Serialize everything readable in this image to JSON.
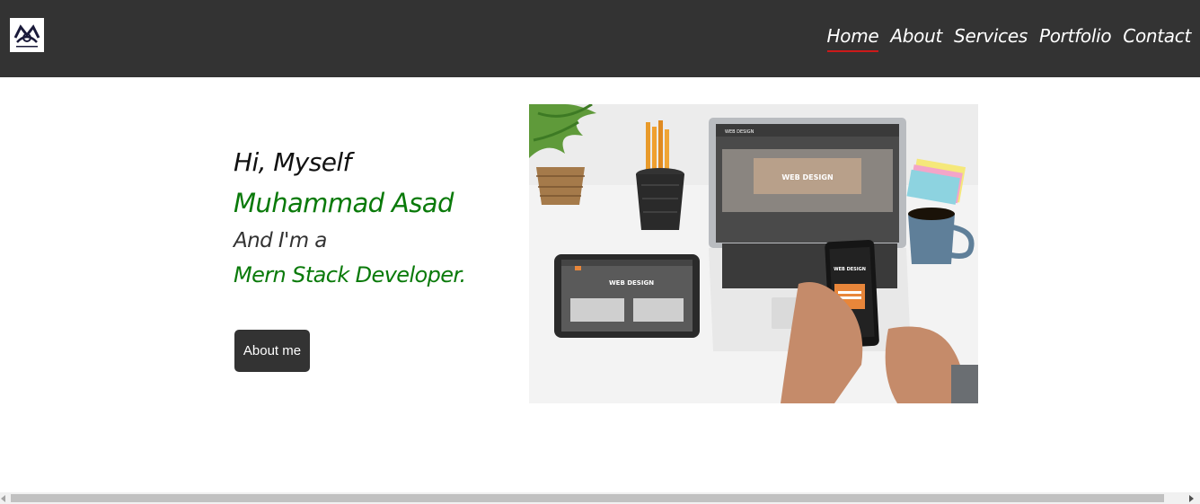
{
  "navbar": {
    "logo_icon": "monogram-logo",
    "links": [
      {
        "label": "Home",
        "active": true
      },
      {
        "label": "About",
        "active": false
      },
      {
        "label": "Services",
        "active": false
      },
      {
        "label": "Portfolio",
        "active": false
      },
      {
        "label": "Contact",
        "active": false
      }
    ]
  },
  "hero": {
    "greeting": "Hi, Myself",
    "name": "Muhammad Asad",
    "intro": "And I'm a",
    "role": "Mern Stack Developer.",
    "button_label": "About me",
    "image": {
      "subject": "web-design-workspace-photo",
      "screen_title": "WEB DESIGN"
    }
  },
  "colors": {
    "navbar": "#333333",
    "accent_green": "#0a7a0a",
    "active_underline": "#cc1a1a",
    "button": "#333333"
  }
}
